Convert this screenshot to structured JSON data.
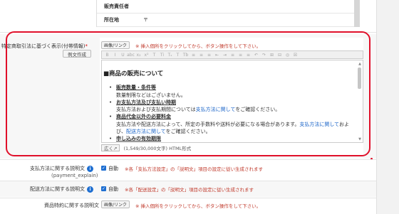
{
  "top_table": {
    "rows": [
      {
        "label": "販売責任者",
        "value": ""
      },
      {
        "label": "所在地",
        "value": "〒"
      }
    ]
  },
  "main_field": {
    "label": "特定商取引法に基づく表示(付帯情報)",
    "required_mark": "*",
    "example_button": "例文作成",
    "image_link_button": "画像/リンク",
    "hint": "※ 挿入個所をクリックしてから、ボタン操作をして下さい。",
    "toolbar_icons": [
      "B",
      "I",
      "U",
      "abc",
      "x₂",
      "x²",
      "T",
      "Ti",
      "Tₛ",
      "T",
      "Tb",
      "≡",
      "≡",
      "≡",
      "⇤",
      "⇥",
      "≡",
      "≡",
      "≡",
      "↶",
      "↷",
      "⊞",
      "⊟",
      "◎",
      "☒"
    ],
    "content": {
      "heading": "■商品の販売について",
      "items": [
        {
          "title": "販売数量・条件等",
          "lines": [
            [
              {
                "t": "数量制限などはございません。"
              }
            ]
          ]
        },
        {
          "title": "お支払方法及び支払い時期",
          "lines": [
            [
              {
                "t": "支払方法および支払期間については"
              },
              {
                "t": "支払方法に関して",
                "link": true
              },
              {
                "t": "をご確認ください。"
              }
            ]
          ]
        },
        {
          "title": "商品代金以外の必要料金",
          "lines": [
            [
              {
                "t": "支払方法や配送方法によって、所定の手数料や送料が必要になる場合があります。"
              },
              {
                "t": "支払方法に関して",
                "link": true
              },
              {
                "t": "およ"
              }
            ],
            [
              {
                "t": "び、"
              },
              {
                "t": "配送方法に関して",
                "link": true
              },
              {
                "t": "をご確認ください。"
              }
            ]
          ]
        },
        {
          "title": "申し込みの有効期限",
          "lines": []
        }
      ]
    },
    "status": {
      "expand_label": "広く↗",
      "char_count": "(1,549/30,000文字) HTML形式"
    }
  },
  "payment_row": {
    "label": "支払方法に関する説明文",
    "sub_label": "(payment_explain)",
    "checkbox_label": "自動",
    "note": "※各「支払方法設定」の「説明文」項目の設定に従い生成されます"
  },
  "delivery_row": {
    "label": "配送方法に関する説明文",
    "checkbox_label": "自動",
    "note": "※各「配送設定」の「説明文」項目の設定に従い生成されます"
  },
  "special_row": {
    "label": "資品特約に関する説明文",
    "image_link_button": "画像/リンク",
    "hint": "※ 挿入個所をクリックしてから、ボタン操作をして下さい。"
  }
}
